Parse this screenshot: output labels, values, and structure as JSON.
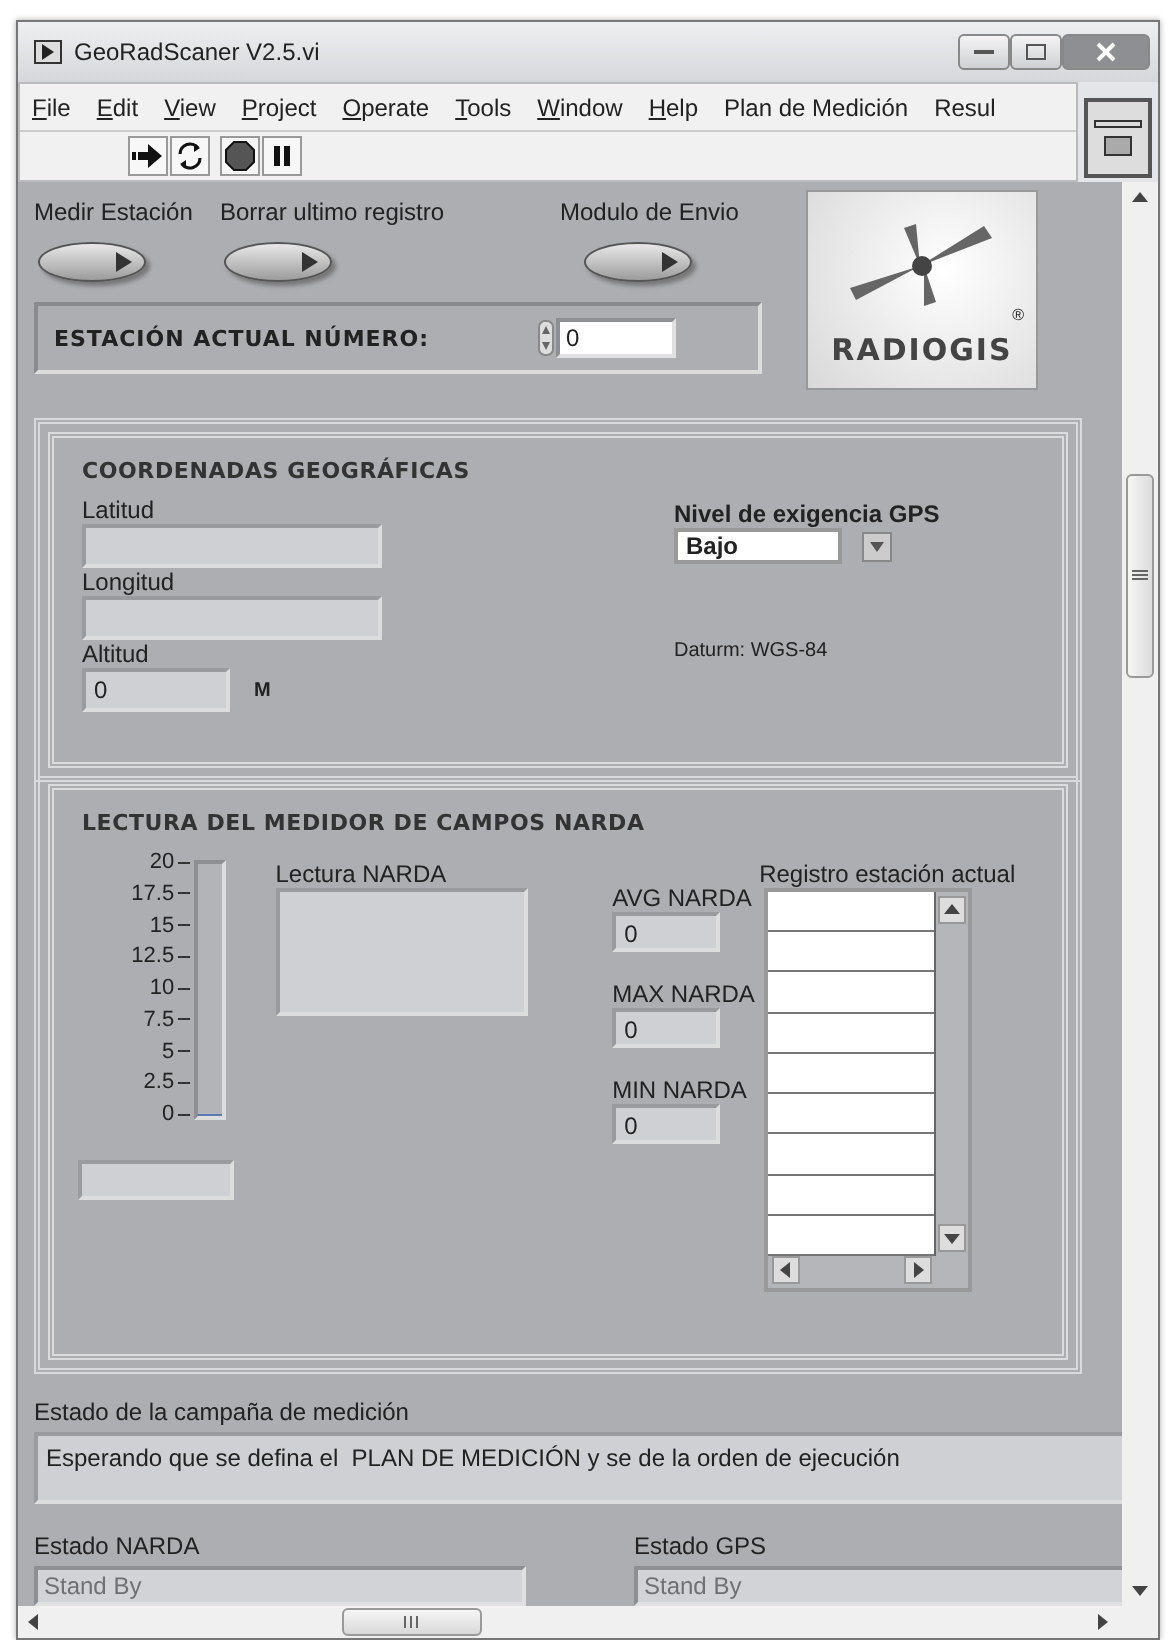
{
  "window": {
    "title": "GeoRadScaner V2.5.vi"
  },
  "menu": [
    {
      "label": "File",
      "underlined_first": true
    },
    {
      "label": "Edit",
      "underlined_first": true
    },
    {
      "label": "View",
      "underlined_first": true
    },
    {
      "label": "Project",
      "underlined_first": true
    },
    {
      "label": "Operate",
      "underlined_first": true
    },
    {
      "label": "Tools",
      "underlined_first": true
    },
    {
      "label": "Window",
      "underlined_first": true
    },
    {
      "label": "Help",
      "underlined_first": true
    },
    {
      "label": "Plan de Medición",
      "underlined_first": false
    },
    {
      "label": "Resul",
      "underlined_first": false
    }
  ],
  "toolbar": [
    {
      "kind": "run"
    },
    {
      "kind": "run_continuous"
    },
    {
      "kind": "abort"
    },
    {
      "kind": "pause"
    }
  ],
  "switches": [
    {
      "label": "Medir Estación"
    },
    {
      "label": "Borrar ultimo registro"
    },
    {
      "label": "Modulo de Envio"
    }
  ],
  "station": {
    "label": "ESTACIÓN ACTUAL NÚMERO:",
    "value": "0"
  },
  "logo": {
    "text": "RADIOGIS",
    "mark": "®"
  },
  "coordinates": {
    "title": "COORDENADAS GEOGRÁFICAS",
    "fields": [
      {
        "label": "Latitud",
        "kind": "wide"
      },
      {
        "label": "Longitud",
        "kind": "wide"
      },
      {
        "label": "Altitud",
        "value": "0",
        "kind": "unit",
        "unit": "M"
      }
    ],
    "gps_level": {
      "label": "Nivel de exigencia GPS",
      "value": "Bajo"
    },
    "datum": "Daturm: WGS-84"
  },
  "narda": {
    "title": "LECTURA DEL MEDIDOR DE CAMPOS NARDA",
    "gauge": {
      "ticks": [
        "20",
        "17.5",
        "15",
        "12.5",
        "10",
        "7.5",
        "5",
        "2.5",
        "0"
      ],
      "level": 0
    },
    "reading_label": "Lectura NARDA",
    "stats": [
      {
        "label": "AVG NARDA",
        "value": "0"
      },
      {
        "label": "MAX NARDA",
        "value": "0"
      },
      {
        "label": "MIN NARDA",
        "value": "0"
      }
    ],
    "log_label": "Registro estación actual"
  },
  "campaign": {
    "label": "Estado de la campaña de medición",
    "value": "Esperando que se defina el  PLAN DE MEDICIÓN y se de la orden de ejecución"
  },
  "devices": [
    {
      "label": "Estado NARDA",
      "value": "Stand By",
      "disabled": true
    },
    {
      "label": "Estado GPS",
      "value": "Stand By",
      "disabled": true
    }
  ]
}
